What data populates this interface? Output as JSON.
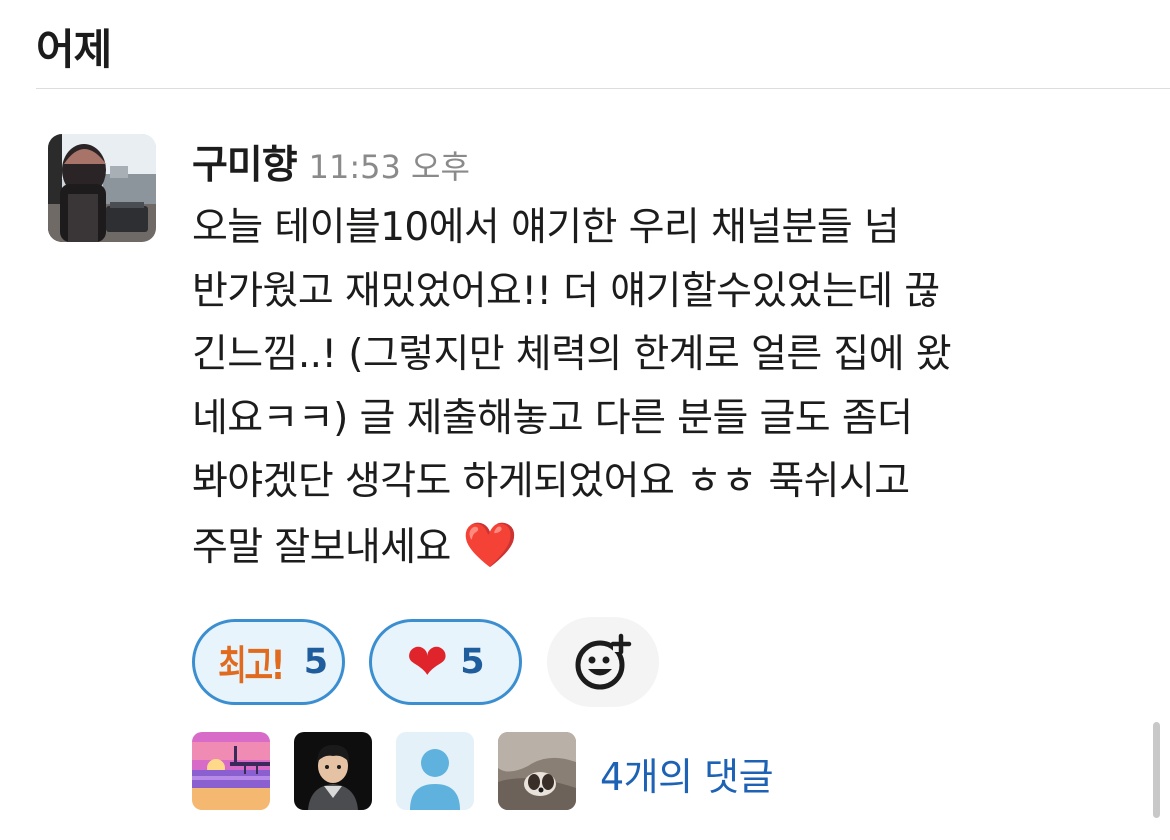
{
  "day_header": "어제",
  "message": {
    "author": "구미향",
    "timestamp": "11:53 오후",
    "text_lines": [
      "오늘 테이블10에서 얘기한 우리 채널분들 넘",
      "반가웠고 재밌었어요!! 더 얘기할수있었는데 끊",
      "긴느낌..! (그렇지만 체력의 한계로 얼른 집에 왔",
      "네요ㅋㅋ) 글 제출해놓고 다른 분들 글도 좀더",
      "봐야겠단 생각도 하게되었어요 ㅎㅎ 푹쉬시고",
      "주말 잘보내세요"
    ],
    "trailing_emoji": "❤️"
  },
  "reactions": [
    {
      "emoji_label": "최고!",
      "count": "5",
      "icon": "choego-custom-emoji"
    },
    {
      "emoji_label": "❤",
      "count": "5",
      "icon": "red-heart-emoji"
    }
  ],
  "add_reaction_icon": "add-reaction-smiley-icon",
  "thread": {
    "reply_text": "4개의 댓글",
    "participant_avatars": [
      "sunset-pier-avatar",
      "3d-character-avatar",
      "default-person-avatar",
      "dog-photo-avatar"
    ]
  },
  "colors": {
    "accent_link": "#1d62b4",
    "reaction_border": "#3b8ed0",
    "reaction_bg": "#e8f4fb",
    "heart": "#e0242b",
    "timestamp": "#8a8a8a"
  }
}
